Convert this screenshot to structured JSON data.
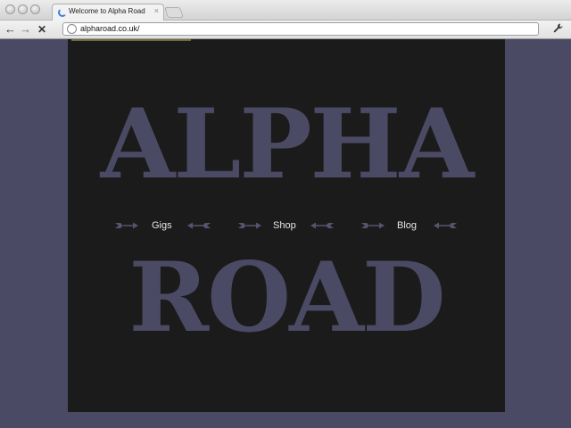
{
  "browser": {
    "tab_title": "Welcome to Alpha Road",
    "tab_close": "×",
    "url": "alpharoad.co.uk/",
    "back": "←",
    "forward": "→",
    "stop": "✕",
    "wrench": "🔧"
  },
  "page": {
    "heading_top": "ALPHA",
    "heading_bottom": "ROAD",
    "nav": [
      "Gigs",
      "Shop",
      "Blog"
    ]
  },
  "colors": {
    "background": "#4b4a64",
    "panel": "#1b1b1b",
    "accent": "#4b4a64",
    "nav_text": "#e6e6e6"
  }
}
